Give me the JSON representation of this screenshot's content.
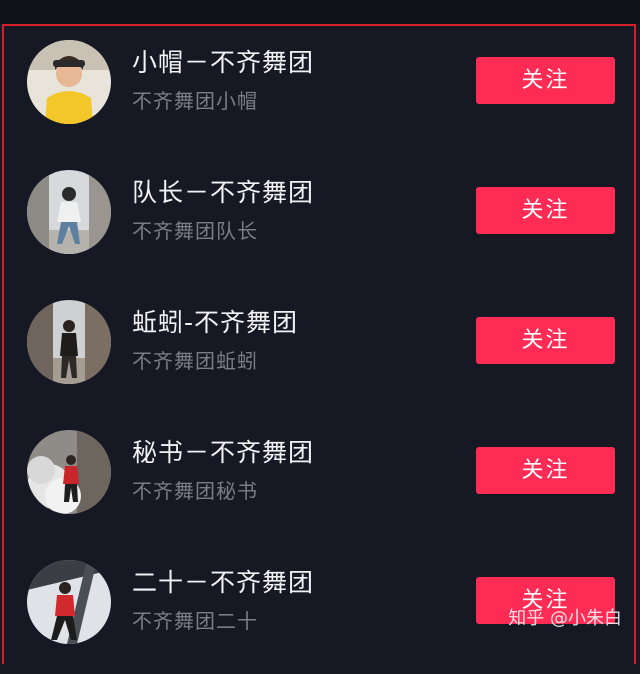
{
  "users": [
    {
      "name": "小帽－不齐舞团",
      "subtitle": "不齐舞团小帽",
      "button": "关注",
      "avatar_icon": "avatar-yellow-shirt-icon"
    },
    {
      "name": "队长－不齐舞团",
      "subtitle": "不齐舞团队长",
      "button": "关注",
      "avatar_icon": "avatar-street-pose-icon"
    },
    {
      "name": "蚯蚓-不齐舞团",
      "subtitle": "不齐舞团蚯蚓",
      "button": "关注",
      "avatar_icon": "avatar-alley-icon"
    },
    {
      "name": "秘书－不齐舞团",
      "subtitle": "不齐舞团秘书",
      "button": "关注",
      "avatar_icon": "avatar-smoke-icon"
    },
    {
      "name": "二十－不齐舞团",
      "subtitle": "不齐舞团二十",
      "button": "关注",
      "avatar_icon": "avatar-red-hoodie-icon"
    }
  ],
  "watermark": "知乎 @小朱白",
  "colors": {
    "background": "#161823",
    "follow_button": "#fe2c55",
    "highlight_border": "#d81e28",
    "name_text": "#f2f2f4",
    "subtitle_text": "#7b7c86"
  }
}
